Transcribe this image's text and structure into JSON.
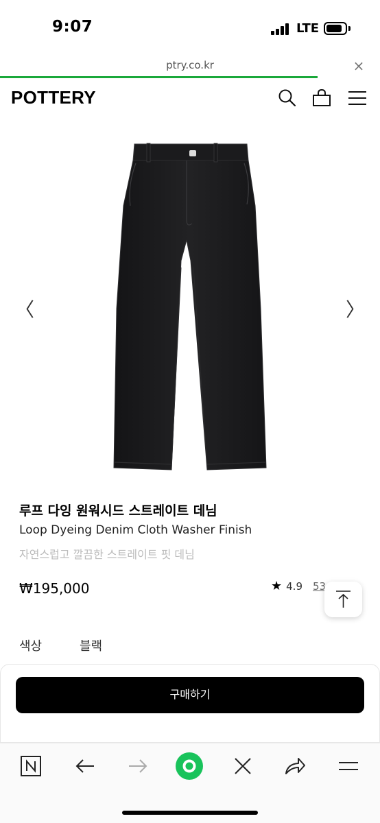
{
  "status": {
    "time": "9:07",
    "network": "LTE"
  },
  "browser": {
    "url": "ptry.co.kr",
    "close_label": "×",
    "load_progress": 0.835
  },
  "header": {
    "logo": "POTTERY",
    "icons": [
      "search-icon",
      "bag-icon",
      "menu-icon"
    ]
  },
  "gallery": {
    "prev_label": "〈",
    "next_label": "〉"
  },
  "product": {
    "title": "루프 다잉 원워시드 스트레이트 데님",
    "subtitle": "Loop Dyeing Denim Cloth Washer Finish",
    "description": "자연스럽고 깔끔한 스트레이트 핏 데님",
    "price": "₩195,000",
    "rating": "4.9",
    "review_count": "53"
  },
  "options": {
    "label": "색상",
    "value": "블랙"
  },
  "purchase": {
    "button_label": "구매하기"
  },
  "toolbar": {
    "icons": [
      "naver-icon",
      "back-icon",
      "forward-icon",
      "green-dot-icon",
      "close-icon",
      "share-icon",
      "hamburger-icon"
    ]
  },
  "colors": {
    "accent_green": "#1aa83a",
    "green_dot": "#19c35b",
    "denim": "#1a1a1c"
  }
}
